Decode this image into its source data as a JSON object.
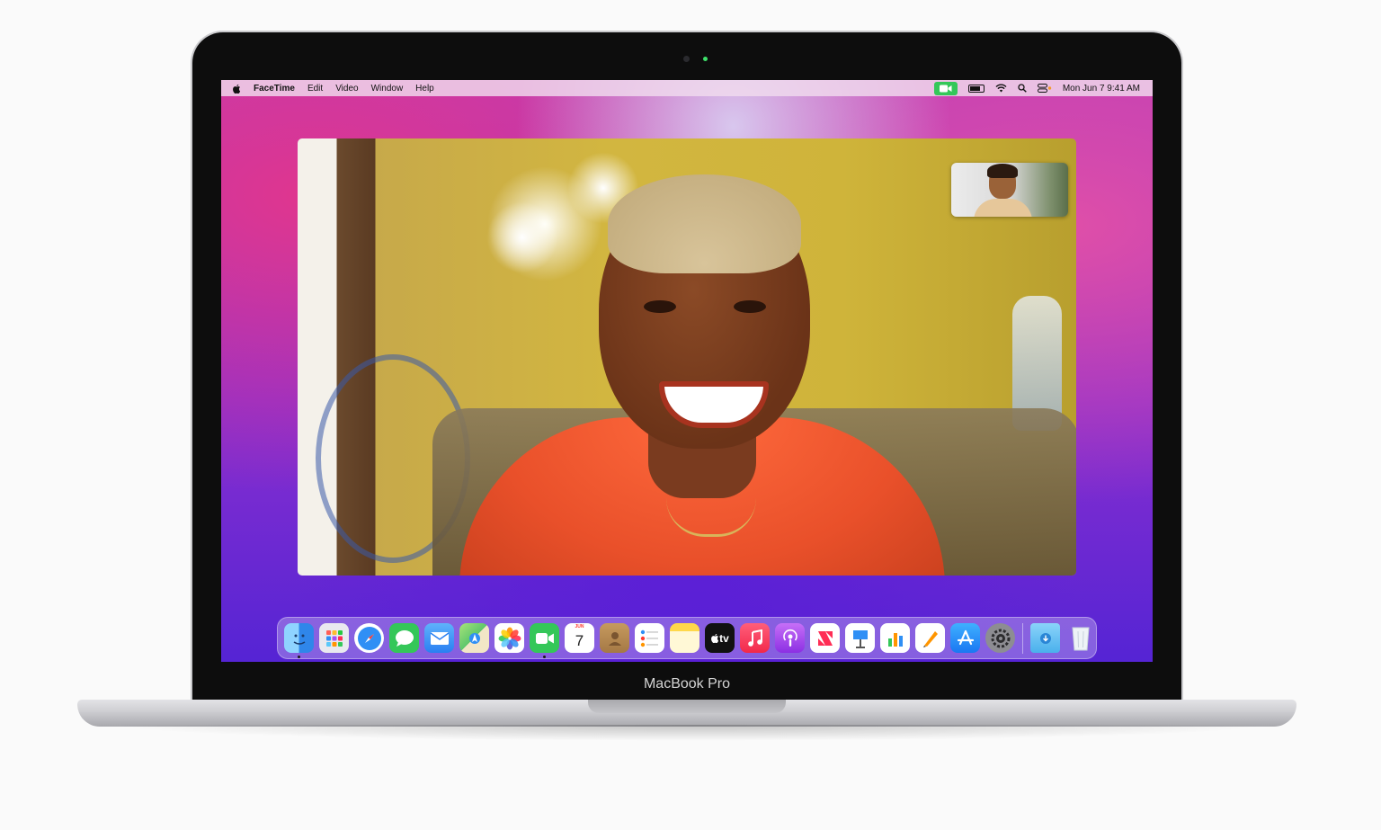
{
  "menubar": {
    "apple_icon": "apple-logo-icon",
    "app_name": "FaceTime",
    "menus": [
      "Edit",
      "Video",
      "Window",
      "Help"
    ],
    "status_icons": [
      "facetime-active-icon",
      "battery-icon",
      "wifi-icon",
      "search-icon",
      "control-center-icon"
    ],
    "datetime": "Mon Jun 7  9:41 AM"
  },
  "dock": {
    "apps": [
      {
        "name": "finder-icon",
        "color": "#3f9bf0",
        "running": true
      },
      {
        "name": "launchpad-icon",
        "color": "#e8e8ee",
        "running": false
      },
      {
        "name": "safari-icon",
        "color": "#2f8ff5",
        "running": false
      },
      {
        "name": "messages-icon",
        "color": "#34c759",
        "running": false
      },
      {
        "name": "mail-icon",
        "color": "#3a8ef6",
        "running": false
      },
      {
        "name": "maps-icon",
        "color": "#5dc66b",
        "running": false
      },
      {
        "name": "photos-icon",
        "color": "#ffffff",
        "running": false
      },
      {
        "name": "facetime-icon",
        "color": "#34c759",
        "running": true
      },
      {
        "name": "calendar-icon",
        "color": "#ffffff",
        "running": false
      },
      {
        "name": "contacts-icon",
        "color": "#b3874f",
        "running": false
      },
      {
        "name": "reminders-icon",
        "color": "#ffffff",
        "running": false
      },
      {
        "name": "notes-icon",
        "color": "#fff6c2",
        "running": false
      },
      {
        "name": "tv-icon",
        "color": "#111111",
        "running": false
      },
      {
        "name": "music-icon",
        "color": "#fb3c5a",
        "running": false
      },
      {
        "name": "podcasts-icon",
        "color": "#a84ef0",
        "running": false
      },
      {
        "name": "news-icon",
        "color": "#ffffff",
        "running": false
      },
      {
        "name": "keynote-icon",
        "color": "#ffffff",
        "running": false
      },
      {
        "name": "numbers-icon",
        "color": "#ffffff",
        "running": false
      },
      {
        "name": "pages-icon",
        "color": "#ffffff",
        "running": false
      },
      {
        "name": "app-store-icon",
        "color": "#1e8ff5",
        "running": false
      },
      {
        "name": "system-preferences-icon",
        "color": "#7b7b80",
        "running": false
      }
    ],
    "calendar": {
      "month": "JUN",
      "day": "7"
    },
    "tv_label": "tv",
    "trailing": [
      {
        "name": "downloads-folder-icon",
        "color": "#6cc3f0"
      },
      {
        "name": "trash-icon",
        "color": "#e9eef3"
      }
    ]
  },
  "facetime": {
    "remote_participant": "remote-video-feed",
    "self_view": "self-view-pip"
  },
  "device": {
    "label": "MacBook Pro"
  }
}
